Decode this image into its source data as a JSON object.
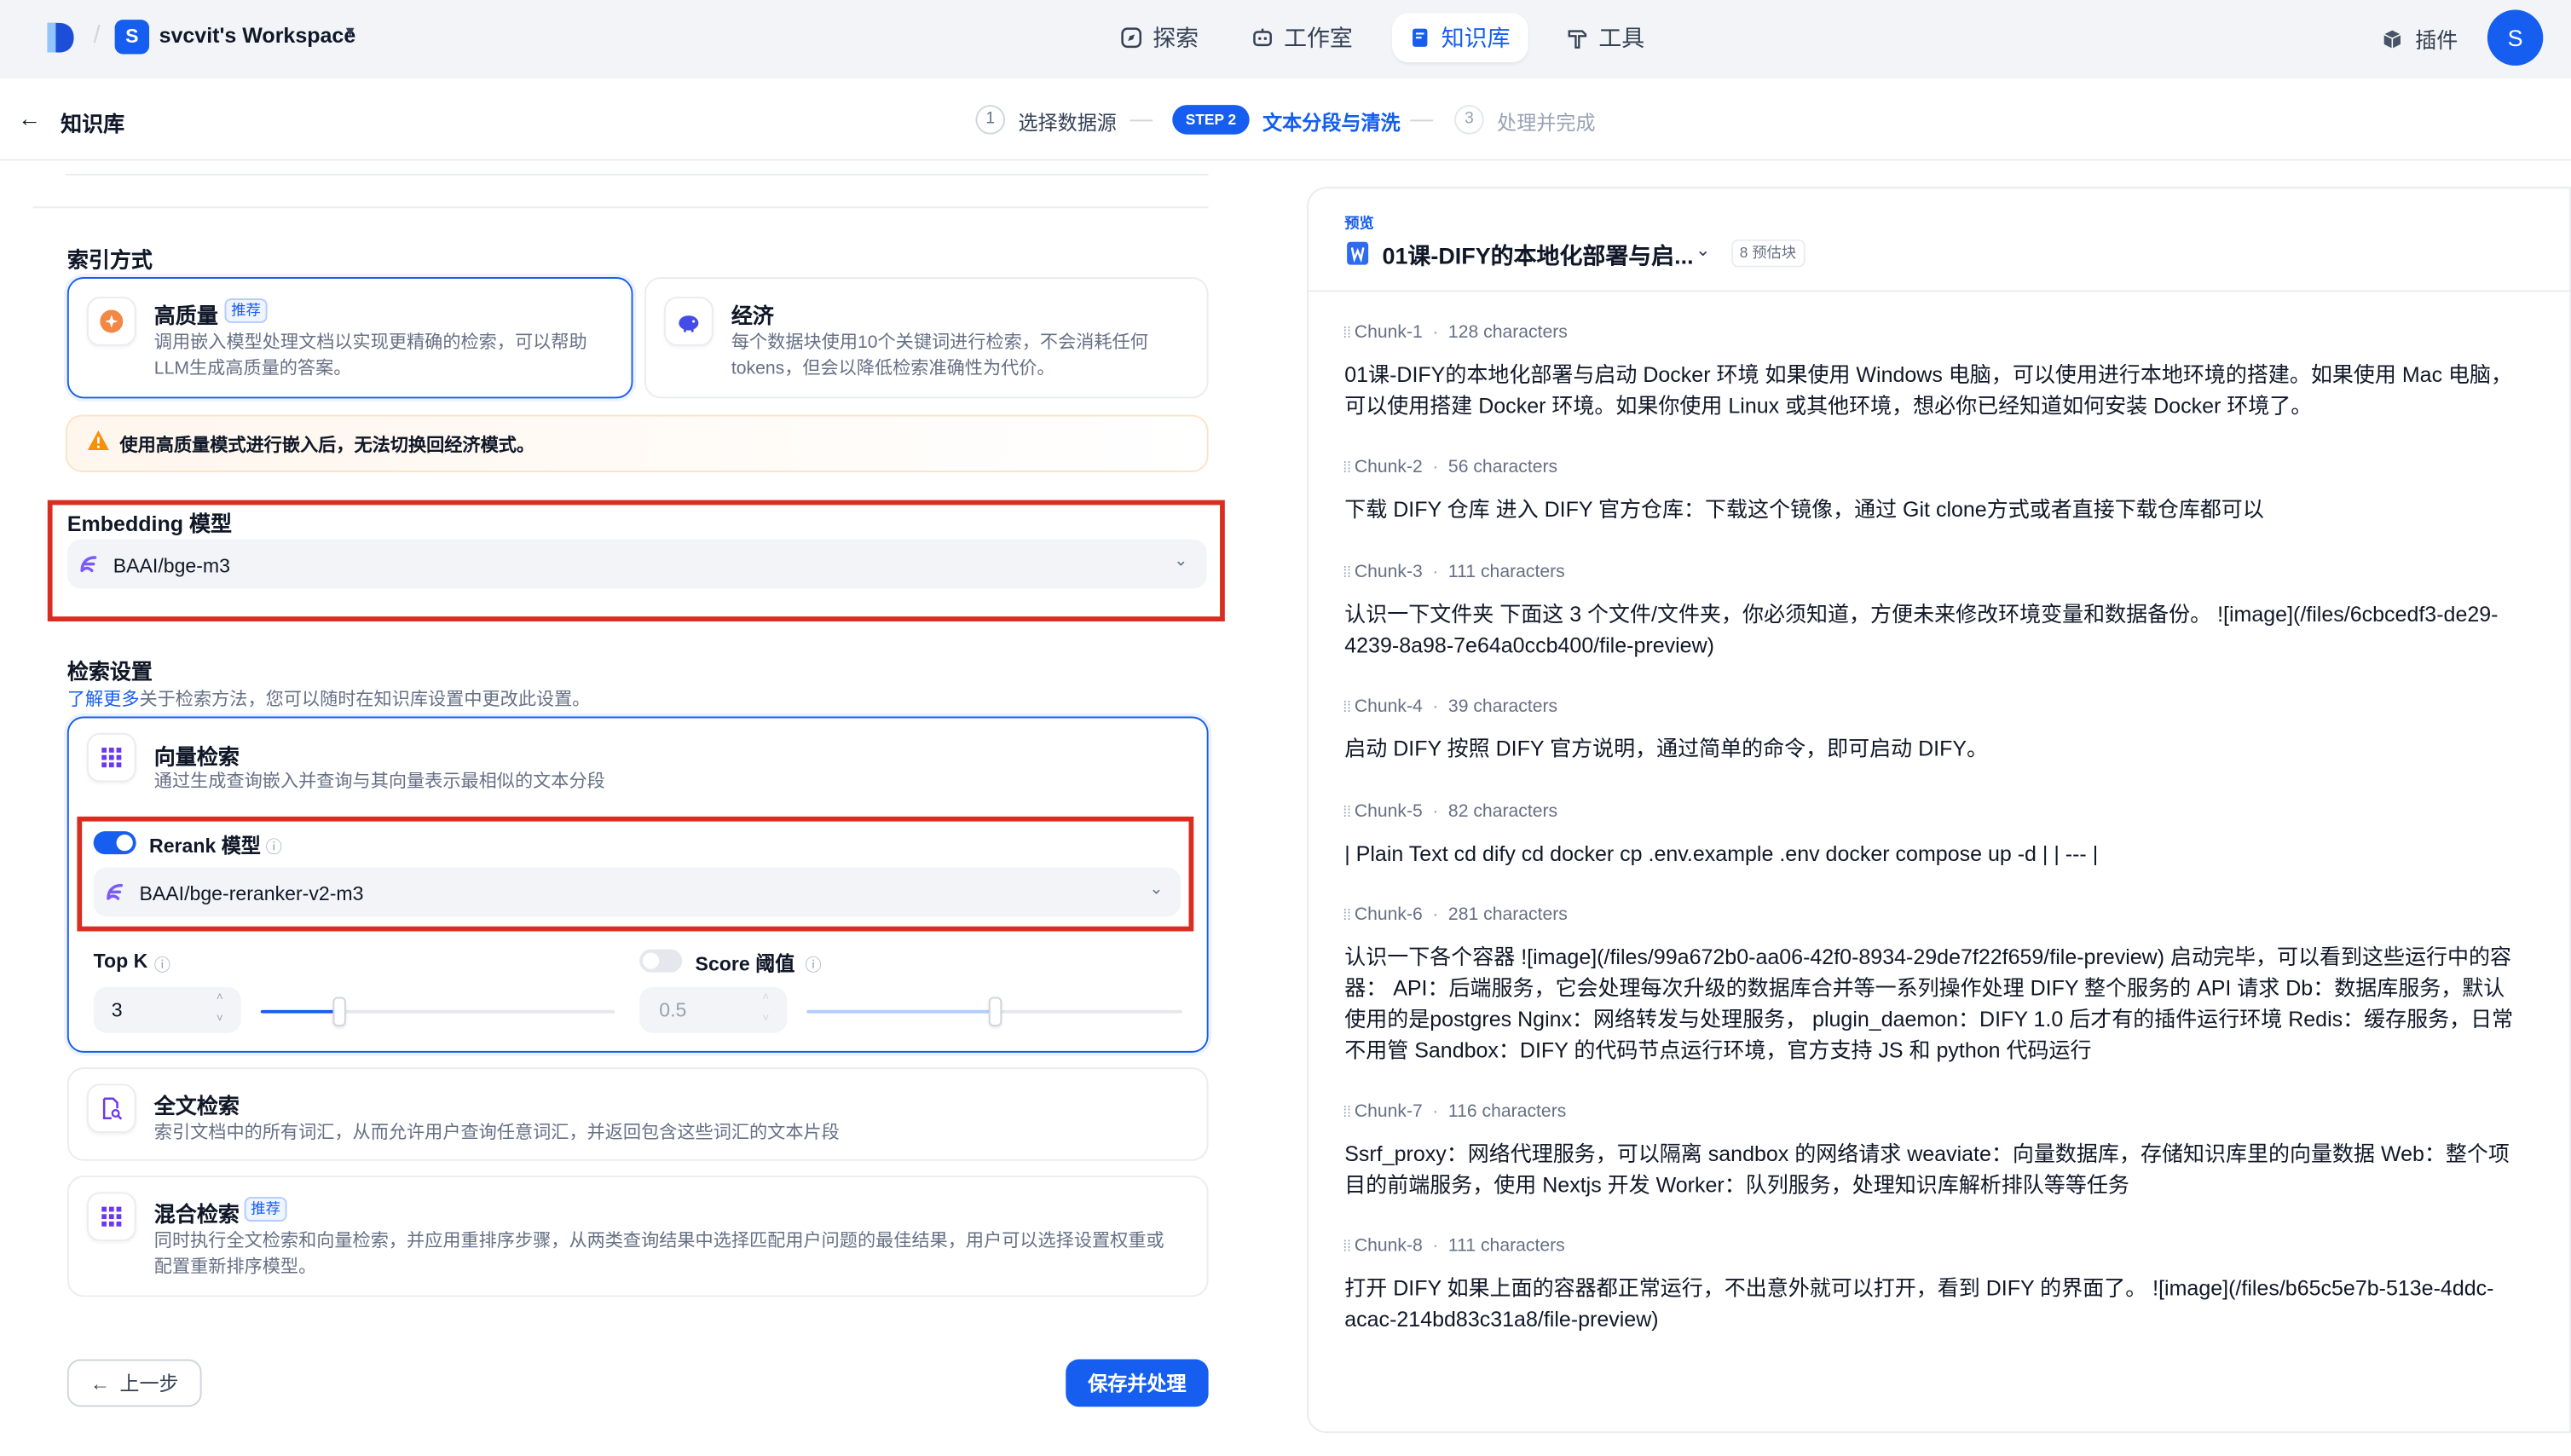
{
  "header": {
    "workspace_initial": "S",
    "workspace_name": "svcvit's Workspace",
    "nav": [
      {
        "label": "探索"
      },
      {
        "label": "工作室"
      },
      {
        "label": "知识库"
      },
      {
        "label": "工具"
      }
    ],
    "plugin_label": "插件",
    "user_initial": "S"
  },
  "subheader": {
    "back_label": "知识库",
    "steps": [
      {
        "num": "1",
        "label": "选择数据源"
      },
      {
        "pill": "STEP 2",
        "label": "文本分段与清洗"
      },
      {
        "num": "3",
        "label": "处理并完成"
      }
    ]
  },
  "index": {
    "title": "索引方式",
    "high": {
      "title": "高质量",
      "tag": "推荐",
      "desc": "调用嵌入模型处理文档以实现更精确的检索，可以帮助LLM生成高质量的答案。"
    },
    "eco": {
      "title": "经济",
      "desc": "每个数据块使用10个关键词进行检索，不会消耗任何 tokens，但会以降低检索准确性为代价。"
    },
    "warning": "使用高质量模式进行嵌入后，无法切换回经济模式。"
  },
  "embedding": {
    "title": "Embedding 模型",
    "model": "BAAI/bge-m3"
  },
  "retrieval": {
    "title": "检索设置",
    "link": "了解更多",
    "desc": "关于检索方法，您可以随时在知识库设置中更改此设置。",
    "vector": {
      "title": "向量检索",
      "desc": "通过生成查询嵌入并查询与其向量表示最相似的文本分段"
    },
    "rerank": {
      "label": "Rerank 模型",
      "model": "BAAI/bge-reranker-v2-m3",
      "enabled": true
    },
    "topk": {
      "label": "Top K",
      "value": "3",
      "slider": 0.22
    },
    "score": {
      "label": "Score 阈值",
      "value": "0.5",
      "slider": 0.5,
      "enabled": false
    },
    "fulltext": {
      "title": "全文检索",
      "desc": "索引文档中的所有词汇，从而允许用户查询任意词汇，并返回包含这些词汇的文本片段"
    },
    "hybrid": {
      "title": "混合检索",
      "tag": "推荐",
      "desc": "同时执行全文检索和向量检索，并应用重排序步骤，从两类查询结果中选择匹配用户问题的最佳结果，用户可以选择设置权重或配置重新排序模型。"
    }
  },
  "footer": {
    "prev": "上一步",
    "save": "保存并处理"
  },
  "preview": {
    "label": "预览",
    "doc_title": "01课-DIFY的本地化部署与启...",
    "estimate": "8 预估块",
    "chunks": [
      {
        "id": "Chunk-1",
        "chars": "128 characters",
        "text": "01课-DIFY的本地化部署与启动 Docker 环境 如果使用 Windows 电脑，可以使用进行本地环境的搭建。如果使用 Mac 电脑，可以使用搭建 Docker 环境。如果你使用 Linux 或其他环境，想必你已经知道如何安装 Docker 环境了。"
      },
      {
        "id": "Chunk-2",
        "chars": "56 characters",
        "text": "下载 DIFY 仓库 进入 DIFY 官方仓库：下载这个镜像，通过 Git clone方式或者直接下载仓库都可以"
      },
      {
        "id": "Chunk-3",
        "chars": "111 characters",
        "text": "认识一下文件夹 下面这 3 个文件/文件夹，你必须知道，方便未来修改环境变量和数据备份。 ![image](/files/6cbcedf3-de29-4239-8a98-7e64a0ccb400/file-preview)"
      },
      {
        "id": "Chunk-4",
        "chars": "39 characters",
        "text": "启动 DIFY 按照 DIFY 官方说明，通过简单的命令，即可启动 DIFY。"
      },
      {
        "id": "Chunk-5",
        "chars": "82 characters",
        "text": "| Plain Text cd dify cd docker cp .env.example .env docker compose up -d | | --- |"
      },
      {
        "id": "Chunk-6",
        "chars": "281 characters",
        "text": "认识一下各个容器 ![image](/files/99a672b0-aa06-42f0-8934-29de7f22f659/file-preview) 启动完毕，可以看到这些运行中的容器： API：后端服务，它会处理每次升级的数据库合并等一系列操作处理 DIFY 整个服务的 API 请求 Db：数据库服务，默认使用的是postgres Nginx：网络转发与处理服务， plugin_daemon：DIFY 1.0 后才有的插件运行环境 Redis：缓存服务，日常不用管 Sandbox：DIFY 的代码节点运行环境，官方支持 JS 和 python 代码运行"
      },
      {
        "id": "Chunk-7",
        "chars": "116 characters",
        "text": "Ssrf_proxy：网络代理服务，可以隔离 sandbox 的网络请求 weaviate：向量数据库，存储知识库里的向量数据 Web：整个项目的前端服务，使用 Nextjs 开发 Worker：队列服务，处理知识库解析排队等等任务"
      },
      {
        "id": "Chunk-8",
        "chars": "111 characters",
        "text": "打开 DIFY 如果上面的容器都正常运行，不出意外就可以打开，看到 DIFY 的界面了。 ![image](/files/b65c5e7b-513e-4ddc-acac-214bd83c31a8/file-preview)"
      }
    ]
  },
  "colors": {
    "accent": "#155eef",
    "highlight_box": "#d92d20",
    "warning": "#f79009"
  }
}
